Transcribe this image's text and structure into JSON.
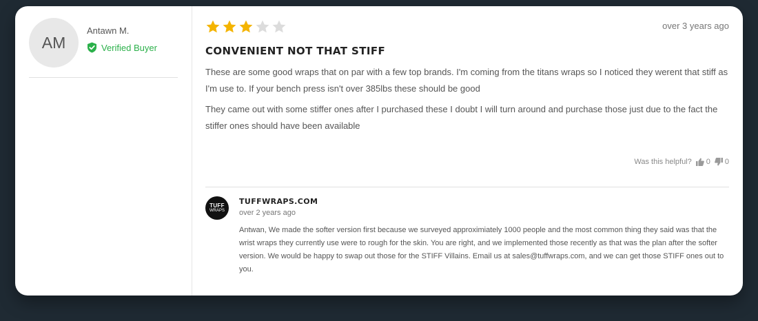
{
  "reviewer": {
    "initials": "AM",
    "name": "Antawn M.",
    "verified_label": "Verified Buyer"
  },
  "review": {
    "rating": 3,
    "max_rating": 5,
    "date": "over 3 years ago",
    "title": "CONVENIENT NOT THAT STIFF",
    "paragraphs": [
      "These are some good wraps that on par with a few top brands. I'm coming from the titans wraps so I noticed they werent that stiff as I'm use to. If your bench press isn't over 385lbs these should be good",
      "They came out with some stiffer ones after I purchased these I doubt I will turn around and purchase those just due to the fact the stiffer ones should have been available"
    ],
    "helpful_label": "Was this helpful?",
    "upvotes": "0",
    "downvotes": "0"
  },
  "reply": {
    "logo_text_top": "TUFF",
    "logo_text_bottom": "WRAPS",
    "author": "TUFFWRAPS.COM",
    "date": "over 2 years ago",
    "text": "Antwan, We made the softer version first because we surveyed approximiately 1000 people and the most common thing they said was that the wrist wraps they currently use were to rough for the skin. You are right, and we implemented those recently as that was the plan after the softer version. We would be happy to swap out those for the STIFF Villains. Email us at sales@tuffwraps.com, and we can get those STIFF ones out to you."
  },
  "colors": {
    "star_filled": "#f4b400",
    "star_empty": "#dcdcdc",
    "verified": "#2bb04a"
  },
  "icons": {
    "verified": "shield-check-icon",
    "upvote": "thumbs-up-icon",
    "downvote": "thumbs-down-icon",
    "star": "star-icon"
  }
}
